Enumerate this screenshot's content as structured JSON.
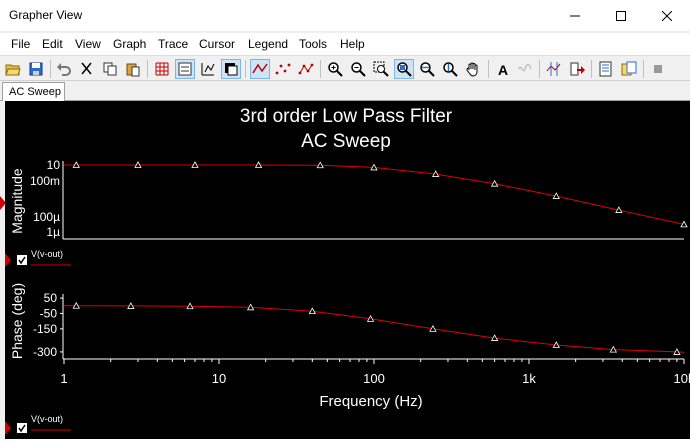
{
  "window": {
    "title": "Grapher View"
  },
  "menu": [
    "File",
    "Edit",
    "View",
    "Graph",
    "Trace",
    "Cursor",
    "Legend",
    "Tools",
    "Help"
  ],
  "tab": {
    "label": "AC Sweep"
  },
  "chart_data": [
    {
      "type": "line",
      "title": "3rd order Low Pass Filter",
      "subtitle": "AC Sweep",
      "xlabel": "",
      "ylabel": "Magnitude",
      "xscale": "log",
      "yscale": "log",
      "xlim": [
        1,
        10000
      ],
      "yticks": [
        "10",
        "100m",
        "100µ",
        "1µ"
      ],
      "grid": false,
      "series": [
        {
          "name": "V(v-out)",
          "color": "#e00000",
          "x": [
            1,
            1.2,
            3,
            7,
            18,
            45,
            100,
            250,
            600,
            1500,
            3800,
            10000
          ],
          "y": [
            1,
            1,
            1,
            1,
            1,
            0.95,
            0.6,
            0.15,
            0.02,
            0.0015,
            8e-05,
            4e-06
          ]
        }
      ]
    },
    {
      "type": "line",
      "xlabel": "Frequency (Hz)",
      "ylabel": "Phase (deg)",
      "xscale": "log",
      "xlim": [
        1,
        10000
      ],
      "ylim": [
        -320,
        70
      ],
      "xticks": [
        "1",
        "10",
        "100",
        "1k",
        "10k"
      ],
      "yticks": [
        50,
        -50,
        -150,
        -300
      ],
      "grid": false,
      "series": [
        {
          "name": "V(v-out)",
          "color": "#e00000",
          "x": [
            1,
            1.2,
            2.7,
            6.5,
            16,
            40,
            95,
            240,
            600,
            1500,
            3500,
            9000,
            10000
          ],
          "y": [
            0,
            0,
            -1,
            -3,
            -10,
            -35,
            -85,
            -150,
            -210,
            -255,
            -285,
            -300,
            -302
          ]
        }
      ]
    }
  ],
  "legend": [
    {
      "label": "V(v-out)",
      "checked": true
    },
    {
      "label": "V(v-out)",
      "checked": true
    }
  ]
}
